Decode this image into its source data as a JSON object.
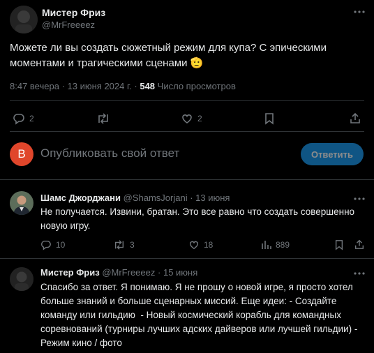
{
  "main_tweet": {
    "author_name": "Мистер Фриз",
    "author_handle": "@MrFreeeez",
    "text_line1": "Можете ли вы создать сюжетный режим для купа? С эпическими",
    "text_line2": "моментами и трагическими сценами",
    "emoji": "🫡",
    "time": "8:47 вечера",
    "sep": "·",
    "date": "13 июня 2024 г.",
    "views_count": "548",
    "views_label": "Число просмотров",
    "replies": "2",
    "likes": "2"
  },
  "compose": {
    "avatar_letter": "B",
    "avatar_color": "#e0462b",
    "placeholder": "Опубликовать свой ответ",
    "button_label": "Ответить"
  },
  "reply1": {
    "author_name": "Шамс Джорджани",
    "author_handle": "@ShamsJorjani",
    "sep": "·",
    "date": "13 июня",
    "text_line1": "Не получается. Извини, братан. Это все равно что создать совершенно",
    "text_line2": "новую игру.",
    "replies": "10",
    "retweets": "3",
    "likes": "18",
    "views": "889"
  },
  "reply2": {
    "author_name": "Мистер Фриз",
    "author_handle": "@MrFreeeez",
    "sep": "·",
    "date": "15 июня",
    "lines": [
      "Спасибо за ответ. Я понимаю. Я не прошу о новой игре, я просто хотел",
      "больше знаний и больше сценарных миссий. Еще идеи: - Создайте",
      "команду или гильдию  - Новый космический корабль для командных",
      "соревнований (турниры лучших адских дайверов или лучшей гильдии) -",
      "Режим кино / фото"
    ]
  },
  "colors": {
    "background": "#000000",
    "text": "#e7e9ea",
    "muted": "#71767b",
    "accent": "#1d9bf0",
    "divider": "#2f3336"
  }
}
